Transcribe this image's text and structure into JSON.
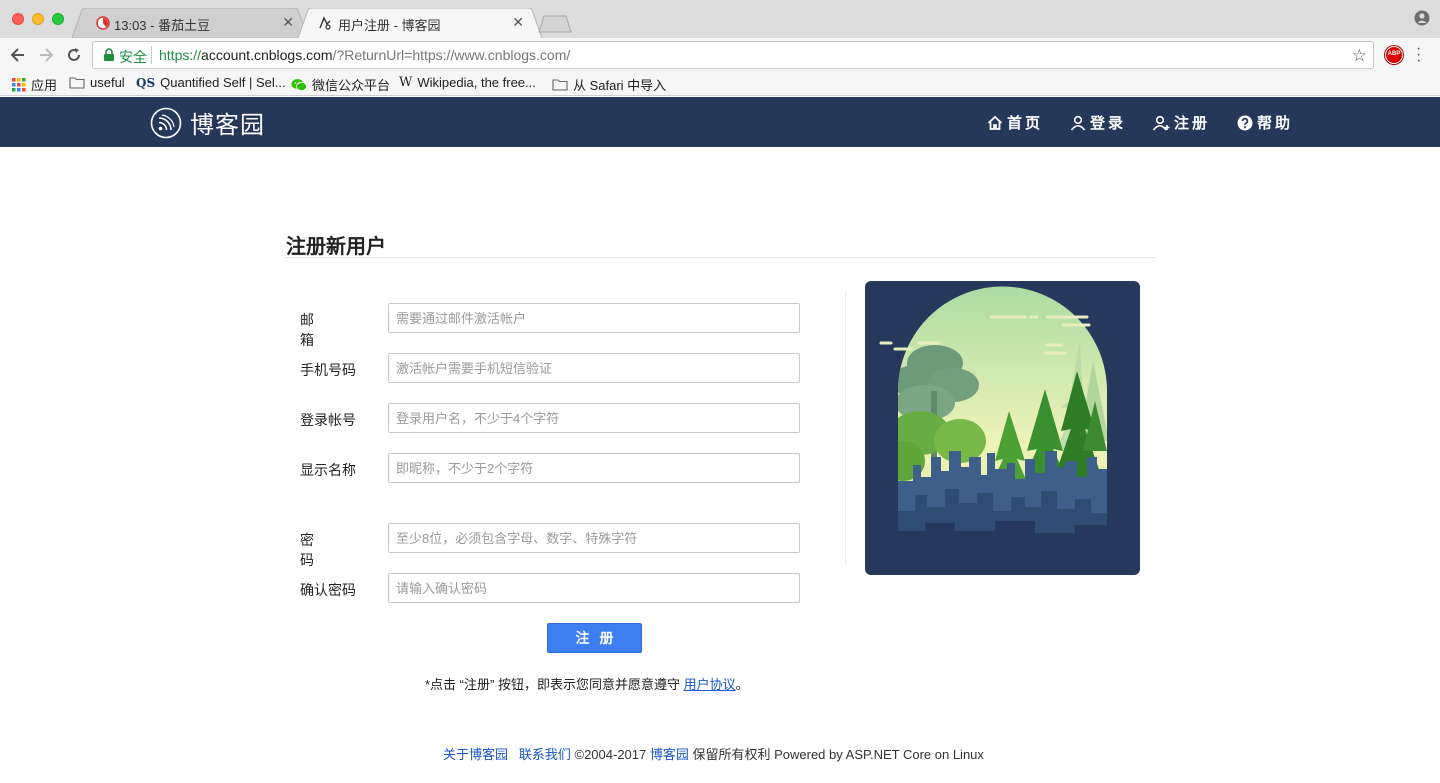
{
  "browser": {
    "tabs": [
      {
        "title": "13:03 - 番茄土豆",
        "active": false
      },
      {
        "title": "用户注册 - 博客园",
        "active": true
      }
    ],
    "omnibox": {
      "secure_label": "安全",
      "url_scheme": "https://",
      "url_host": "account.cnblogs.com",
      "url_rest": "/?ReturnUrl=https://www.cnblogs.com/"
    },
    "bookmarks": [
      {
        "label": "应用",
        "icon": "apps-grid-icon"
      },
      {
        "label": "useful",
        "icon": "folder-icon"
      },
      {
        "label": "Quantified Self | Sel...",
        "icon": "qs-icon",
        "icon_text": "QS"
      },
      {
        "label": "微信公众平台",
        "icon": "wechat-icon"
      },
      {
        "label": "Wikipedia, the free...",
        "icon": "wikipedia-icon",
        "icon_text": "W"
      },
      {
        "label": "从 Safari 中导入",
        "icon": "folder-icon"
      }
    ],
    "extension_badge": "ABP"
  },
  "header": {
    "logo_text": "博客园",
    "nav": [
      {
        "label": "首页",
        "icon": "home-icon"
      },
      {
        "label": "登录",
        "icon": "user-icon"
      },
      {
        "label": "注册",
        "icon": "user-add-icon"
      },
      {
        "label": "帮助",
        "icon": "help-icon"
      }
    ],
    "bg_color": "#25385a"
  },
  "form": {
    "title": "注册新用户",
    "fields": [
      {
        "label": "邮箱",
        "placeholder": "需要通过邮件激活帐户",
        "value": ""
      },
      {
        "label": "手机号码",
        "placeholder": "激活帐户需要手机短信验证",
        "value": ""
      },
      {
        "label": "登录帐号",
        "placeholder": "登录用户名，不少于4个字符",
        "value": ""
      },
      {
        "label": "显示名称",
        "placeholder": "即昵称，不少于2个字符",
        "value": ""
      },
      {
        "label": "密码",
        "placeholder": "至少8位，必须包含字母、数字、特殊字符",
        "value": ""
      },
      {
        "label": "确认密码",
        "placeholder": "请输入确认密码",
        "value": ""
      }
    ],
    "submit_label": "注册",
    "agreement_prefix": "*点击 “注册” 按钮，即表示您同意并愿意遵守 ",
    "agreement_link": "用户协议",
    "agreement_suffix": "。",
    "button_color": "#3d7ff0"
  },
  "footer": {
    "about_link": "关于博客园",
    "contact_link": "联系我们",
    "copyright": " ©2004-2017 ",
    "site_link": "博客园",
    "rights_text": " 保留所有权利 Powered by ASP.NET Core on Linux"
  }
}
